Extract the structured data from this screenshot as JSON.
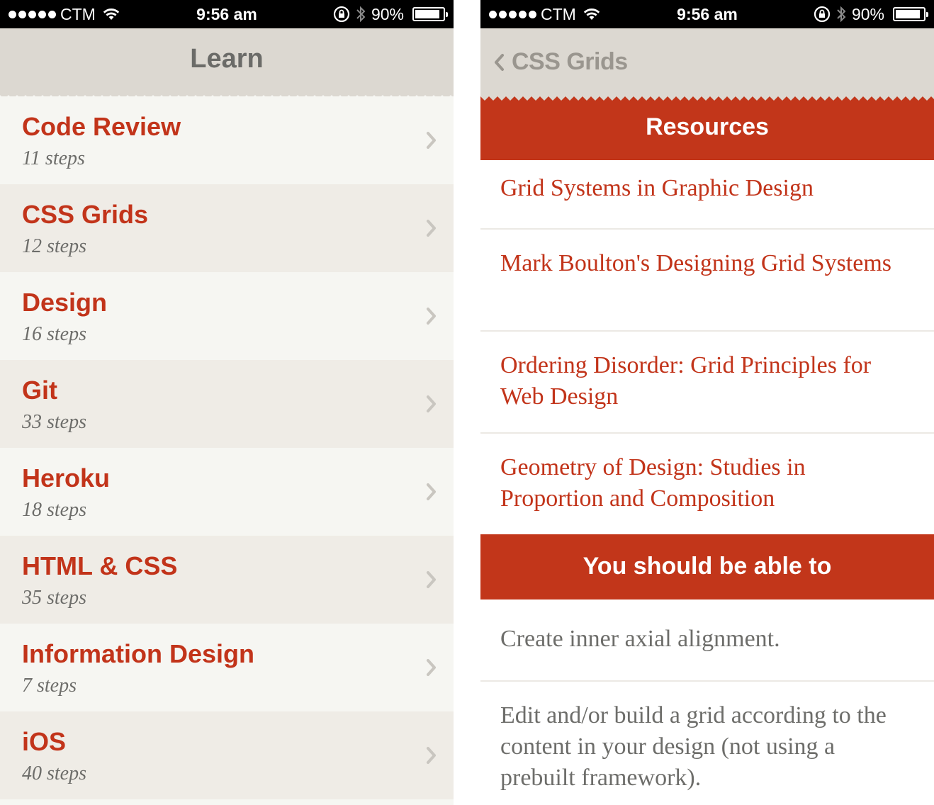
{
  "status_bar": {
    "carrier": "CTM",
    "time": "9:56 am",
    "battery_text": "90%",
    "battery_level": 0.9
  },
  "colors": {
    "accent": "#c2341a",
    "nav_bg": "#dcd8d1",
    "row_light": "#f6f6f2",
    "row_dark": "#efece6",
    "muted_text": "#6d6d6a"
  },
  "left_screen": {
    "nav_title": "Learn",
    "items": [
      {
        "title": "Code Review",
        "subtitle": "11 steps"
      },
      {
        "title": "CSS Grids",
        "subtitle": "12 steps"
      },
      {
        "title": "Design",
        "subtitle": "16 steps"
      },
      {
        "title": "Git",
        "subtitle": "33 steps"
      },
      {
        "title": "Heroku",
        "subtitle": "18 steps"
      },
      {
        "title": "HTML & CSS",
        "subtitle": "35 steps"
      },
      {
        "title": "Information Design",
        "subtitle": "7 steps"
      },
      {
        "title": "iOS",
        "subtitle": "40 steps"
      }
    ]
  },
  "right_screen": {
    "back_label": "CSS Grids",
    "resources_header": "Resources",
    "resources": [
      {
        "text": "Grid Systems in Graphic Design"
      },
      {
        "text": "Mark Boulton's Designing Grid Systems"
      },
      {
        "text": "Ordering Disorder: Grid Principles for Web Design"
      },
      {
        "text": "Geometry of Design: Studies in Proportion and Composition"
      }
    ],
    "goals_header": "You should be able to",
    "goals": [
      {
        "text": "Create inner axial alignment."
      },
      {
        "text": "Edit and/or build a grid according to the content in your design (not using a prebuilt framework)."
      }
    ]
  }
}
